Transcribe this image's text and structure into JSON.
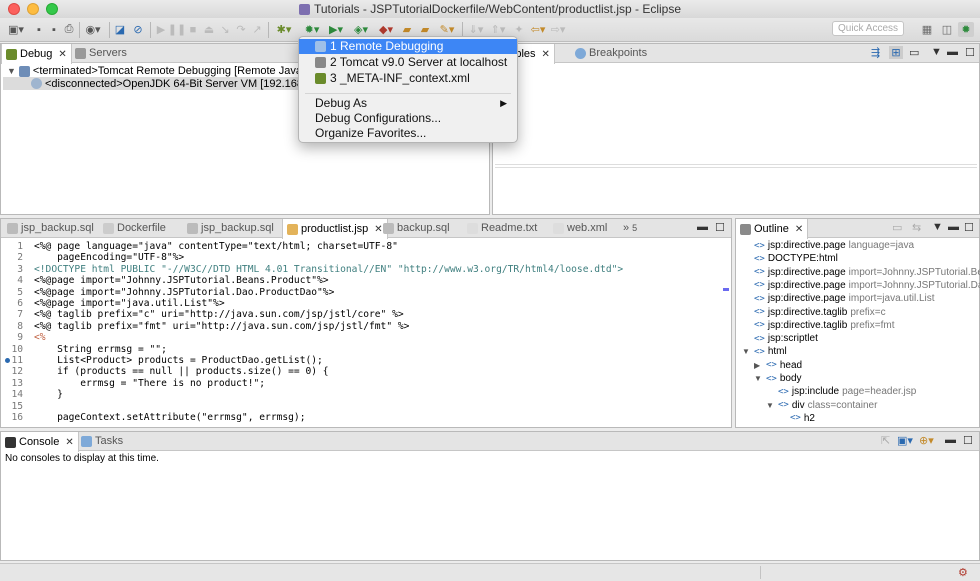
{
  "window": {
    "title": "Tutorials - JSPTutorialDockerfile/WebContent/productlist.jsp - Eclipse"
  },
  "toolbar": {
    "quick_access_placeholder": "Quick Access"
  },
  "debug_view": {
    "tabs": [
      {
        "label": "Debug",
        "active": true
      },
      {
        "label": "Servers",
        "active": false
      }
    ],
    "tree": [
      {
        "label": "<terminated>Tomcat Remote Debugging [Remote Java Application]"
      },
      {
        "label": "<disconnected>OpenJDK 64-Bit Server VM [192.168.99.100"
      }
    ]
  },
  "variables_view": {
    "tabs": [
      {
        "label": "Variables",
        "shown": "ariables"
      },
      {
        "label": "Breakpoints"
      }
    ]
  },
  "debug_menu": {
    "items": [
      {
        "label": "1 Remote Debugging",
        "highlighted": true,
        "icon": "remote-debug-icon"
      },
      {
        "label": "2 Tomcat v9.0 Server at localhost",
        "icon": "server-icon"
      },
      {
        "label": "3 _META-INF_context.xml",
        "icon": "xml-file-icon"
      }
    ],
    "debug_as": "Debug As",
    "debug_configurations": "Debug Configurations...",
    "organize_favorites": "Organize Favorites..."
  },
  "editor": {
    "tabs": [
      {
        "label": "jsp_backup.sql"
      },
      {
        "label": "Dockerfile"
      },
      {
        "label": "jsp_backup.sql"
      },
      {
        "label": "productlist.jsp",
        "active": true
      },
      {
        "label": "backup.sql"
      },
      {
        "label": "Readme.txt"
      },
      {
        "label": "web.xml"
      }
    ],
    "overflow_count": "5",
    "lines": [
      {
        "n": "1",
        "text": "<%@ page language=\"java\" contentType=\"text/html; charset=UTF-8\""
      },
      {
        "n": "2",
        "text": "    pageEncoding=\"UTF-8\"%>"
      },
      {
        "n": "3",
        "text": "<!DOCTYPE html PUBLIC \"-//W3C//DTD HTML 4.01 Transitional//EN\" \"http://www.w3.org/TR/html4/loose.dtd\">"
      },
      {
        "n": "4",
        "text": "<%@page import=\"Johnny.JSPTutorial.Beans.Product\"%>"
      },
      {
        "n": "5",
        "text": "<%@page import=\"Johnny.JSPTutorial.Dao.ProductDao\"%>"
      },
      {
        "n": "6",
        "text": "<%@page import=\"java.util.List\"%>"
      },
      {
        "n": "7",
        "text": "<%@ taglib prefix=\"c\" uri=\"http://java.sun.com/jsp/jstl/core\" %>"
      },
      {
        "n": "8",
        "text": "<%@ taglib prefix=\"fmt\" uri=\"http://java.sun.com/jsp/jstl/fmt\" %>"
      },
      {
        "n": "9",
        "text": "<%"
      },
      {
        "n": "10",
        "text": "    String errmsg = \"\";"
      },
      {
        "n": "11",
        "text": "    List<Product> products = ProductDao.getList();"
      },
      {
        "n": "12",
        "text": "    if (products == null || products.size() == 0) {"
      },
      {
        "n": "13",
        "text": "        errmsg = \"There is no product!\";"
      },
      {
        "n": "14",
        "text": "    }"
      },
      {
        "n": "15",
        "text": ""
      },
      {
        "n": "16",
        "text": "    pageContext.setAttribute(\"errmsg\", errmsg);"
      }
    ]
  },
  "outline": {
    "tab": "Outline",
    "items": [
      {
        "name": "jsp:directive.page",
        "detail": "language=java",
        "depth": 0
      },
      {
        "name": "DOCTYPE:html",
        "detail": "",
        "depth": 0
      },
      {
        "name": "jsp:directive.page",
        "detail": "import=Johnny.JSPTutorial.Beans",
        "depth": 0
      },
      {
        "name": "jsp:directive.page",
        "detail": "import=Johnny.JSPTutorial.Dao.P",
        "depth": 0
      },
      {
        "name": "jsp:directive.page",
        "detail": "import=java.util.List",
        "depth": 0
      },
      {
        "name": "jsp:directive.taglib",
        "detail": "prefix=c",
        "depth": 0
      },
      {
        "name": "jsp:directive.taglib",
        "detail": "prefix=fmt",
        "depth": 0
      },
      {
        "name": "jsp:scriptlet",
        "detail": "",
        "depth": 0
      },
      {
        "name": "html",
        "detail": "",
        "depth": 0,
        "expand": "▼"
      },
      {
        "name": "head",
        "detail": "",
        "depth": 1,
        "expand": "▶"
      },
      {
        "name": "body",
        "detail": "",
        "depth": 1,
        "expand": "▼"
      },
      {
        "name": "jsp:include",
        "detail": "page=header.jsp",
        "depth": 2
      },
      {
        "name": "div",
        "detail": "class=container",
        "depth": 2,
        "expand": "▼"
      },
      {
        "name": "h2",
        "detail": "",
        "depth": 3
      }
    ]
  },
  "console": {
    "tabs": [
      {
        "label": "Console",
        "active": true
      },
      {
        "label": "Tasks"
      }
    ],
    "message": "No consoles to display at this time."
  },
  "colors": {
    "accent": "#3d86f5",
    "editor_tag": "#3f7f7f",
    "editor_attr": "#7f007f",
    "editor_value": "#2a00ff"
  }
}
